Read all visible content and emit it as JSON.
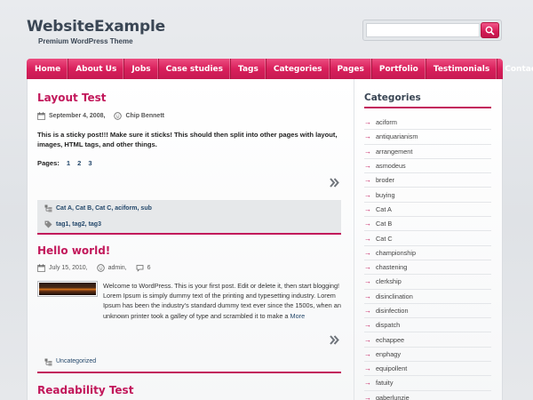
{
  "header": {
    "site_title": "WebsiteExample",
    "tagline": "Premium WordPress Theme"
  },
  "search": {
    "value": "",
    "placeholder": ""
  },
  "nav": {
    "items": [
      "Home",
      "About Us",
      "Jobs",
      "Case studies",
      "Tags",
      "Categories",
      "Pages",
      "Portfolio",
      "Testimonials",
      "Contact"
    ]
  },
  "posts": [
    {
      "title": "Layout Test",
      "date": "September 4, 2008,",
      "author": "Chip Bennett",
      "excerpt": "This is a sticky post!!! Make sure it sticks! This should then split into other pages with layout, images, HTML tags, and other things.",
      "pages_label": "Pages:",
      "pages": [
        "1",
        "2",
        "3"
      ],
      "categories": "Cat A, Cat B, Cat C, aciform, sub",
      "tags": "tag1, tag2, tag3"
    },
    {
      "title": "Hello world!",
      "date": "July 15, 2010,",
      "author": "admin,",
      "comments": "6",
      "excerpt": "Welcome to WordPress. This is your first post. Edit or delete it, then start blogging! Lorem Ipsum is simply dummy text of the printing and typesetting industry. Lorem Ipsum has been the industry's standard dummy text ever since the 1500s, when an unknown printer took a galley of type and scrambled it to make a",
      "more": "More",
      "category": "Uncategorized"
    },
    {
      "title": "Readability Test"
    }
  ],
  "sidebar": {
    "title": "Categories",
    "categories": [
      "aciform",
      "antiquarianism",
      "arrangement",
      "asmodeus",
      "broder",
      "buying",
      "Cat A",
      "Cat B",
      "Cat C",
      "championship",
      "chastening",
      "clerkship",
      "disinclination",
      "disinfection",
      "dispatch",
      "echappee",
      "enphagy",
      "equipollent",
      "fatuity",
      "gaberlunzie"
    ]
  },
  "icons": {
    "more": "double-chevron-right-icon",
    "search": "magnifier-icon",
    "calendar": "calendar-icon",
    "author": "smiley-icon",
    "comments": "comment-bubble-icon",
    "tag": "tag-icon",
    "category": "category-icon"
  },
  "colors": {
    "accent": "#c2185b",
    "nav": "#d9205c",
    "heading": "#3a4654",
    "link": "#24486b"
  }
}
